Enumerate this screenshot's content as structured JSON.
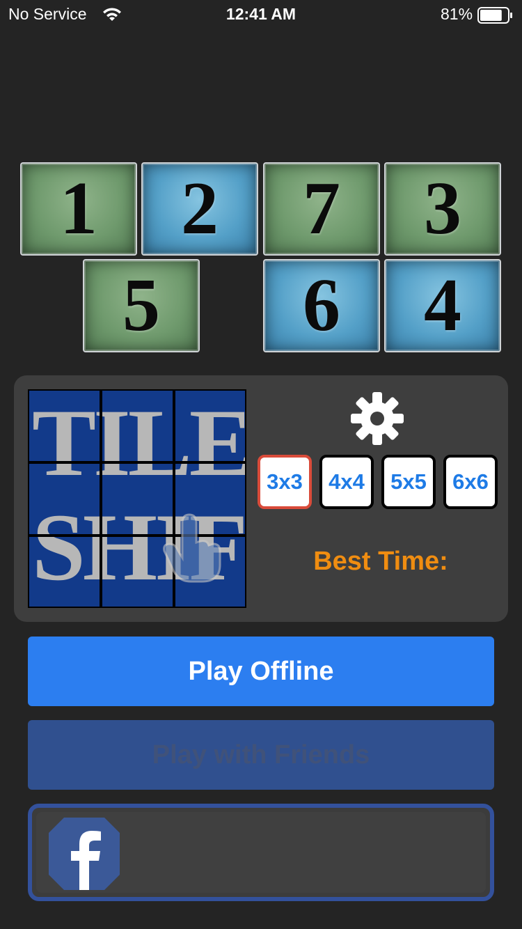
{
  "status_bar": {
    "carrier": "No Service",
    "time": "12:41 AM",
    "battery_percent": "81%",
    "battery_level": 0.81
  },
  "tiles": [
    {
      "number": "1",
      "color": "green"
    },
    {
      "number": "2",
      "color": "blue"
    },
    {
      "number": "7",
      "color": "green"
    },
    {
      "number": "3",
      "color": "green"
    },
    {
      "number": "5",
      "color": "green"
    },
    {
      "number": "6",
      "color": "blue"
    },
    {
      "number": "4",
      "color": "blue"
    }
  ],
  "preview": {
    "logo_words": [
      "TILE",
      "SHIFT"
    ],
    "grid": "3x3"
  },
  "settings": {
    "icon": "gear-icon"
  },
  "size_options": [
    {
      "label": "3x3",
      "selected": true
    },
    {
      "label": "4x4",
      "selected": false
    },
    {
      "label": "5x5",
      "selected": false
    },
    {
      "label": "6x6",
      "selected": false
    }
  ],
  "best_time_label": "Best Time:",
  "buttons": {
    "play_offline": "Play Offline",
    "play_friends": "Play with Friends"
  },
  "facebook": {
    "icon": "facebook-icon"
  },
  "colors": {
    "background": "#242424",
    "panel": "#3e3e3e",
    "primary_blue": "#2c7ef0",
    "friends_blue": "#30508f",
    "best_time_orange": "#f08d11",
    "selected_border": "#d94b3a",
    "facebook_blue": "#3b5998"
  }
}
